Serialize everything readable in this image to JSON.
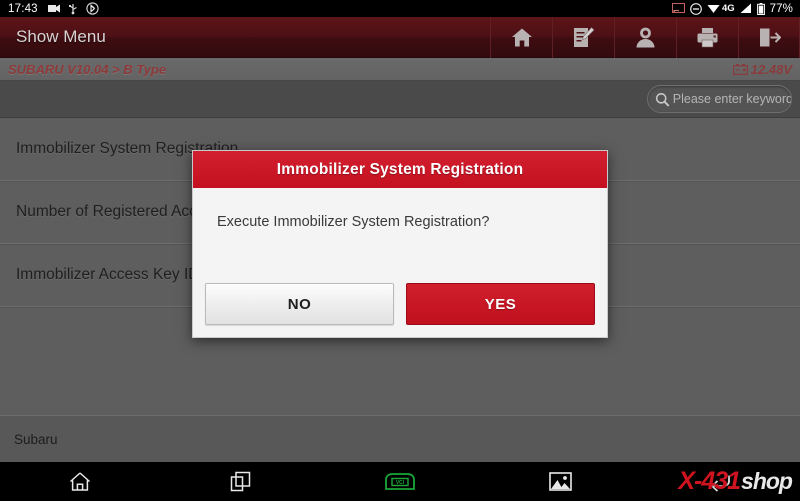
{
  "status_bar": {
    "clock": "17:43",
    "battery_percent": "77%",
    "network_label": "4G",
    "icons": [
      "screenshot-icon",
      "dnd-icon",
      "wifi-icon",
      "signal-icon",
      "battery-icon"
    ]
  },
  "title_bar": {
    "app_title": "Show Menu",
    "tools": [
      {
        "name": "home-icon",
        "label": "Home"
      },
      {
        "name": "notes-icon",
        "label": "Notes"
      },
      {
        "name": "user-icon",
        "label": "User"
      },
      {
        "name": "print-icon",
        "label": "Print"
      },
      {
        "name": "exit-icon",
        "label": "Exit"
      }
    ]
  },
  "path_bar": {
    "breadcrumb": "SUBARU V10.04 > B Type",
    "voltage": "12.48V"
  },
  "search": {
    "placeholder": "Please enter keyword",
    "value": ""
  },
  "menu": {
    "items": [
      {
        "label": "Immobilizer System Registration"
      },
      {
        "label": "Number of Registered Access Keys"
      },
      {
        "label": "Immobilizer Access Key ID Check"
      }
    ]
  },
  "footer": {
    "vehicle": "Subaru"
  },
  "nav_bar": {
    "buttons": [
      {
        "name": "nav-home-icon",
        "label": "Home"
      },
      {
        "name": "nav-recents-icon",
        "label": "Recents"
      },
      {
        "name": "nav-vci-icon",
        "label": "VCI"
      },
      {
        "name": "nav-screenshot-icon",
        "label": "Screenshot"
      },
      {
        "name": "nav-back-icon",
        "label": "Back"
      }
    ]
  },
  "watermark": {
    "brand_red": "X-431",
    "brand_white": "shop"
  },
  "dialog": {
    "title": "Immobilizer System Registration",
    "message": "Execute Immobilizer System Registration?",
    "no_label": "NO",
    "yes_label": "YES"
  },
  "colors": {
    "accent_red": "#c4101f",
    "title_bar_red": "#4d1015",
    "list_gray": "#5e5e5e",
    "vci_green": "#19a836"
  }
}
